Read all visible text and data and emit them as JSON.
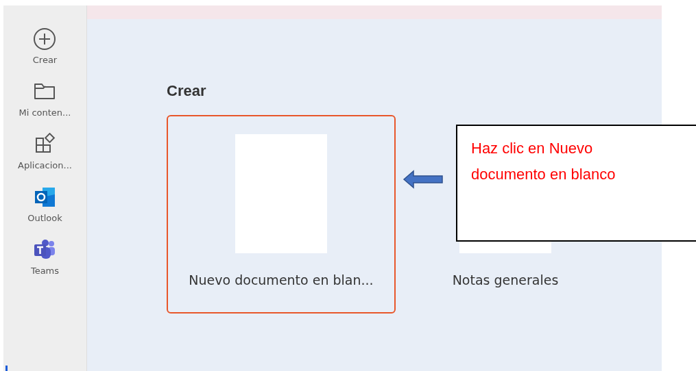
{
  "sidebar": {
    "items": [
      {
        "kind": "create",
        "label": "Crear"
      },
      {
        "kind": "folder",
        "label": "Mi conten..."
      },
      {
        "kind": "apps",
        "label": "Aplicacion..."
      },
      {
        "kind": "outlook",
        "label": "Outlook"
      },
      {
        "kind": "teams",
        "label": "Teams"
      }
    ]
  },
  "section": {
    "title": "Crear",
    "cards": [
      {
        "label": "Nuevo documento en blan...",
        "selected": true
      },
      {
        "label": "Notas generales",
        "selected": false
      }
    ]
  },
  "callout": {
    "lines": [
      "Haz clic en Nuevo",
      "documento en blanco"
    ]
  }
}
